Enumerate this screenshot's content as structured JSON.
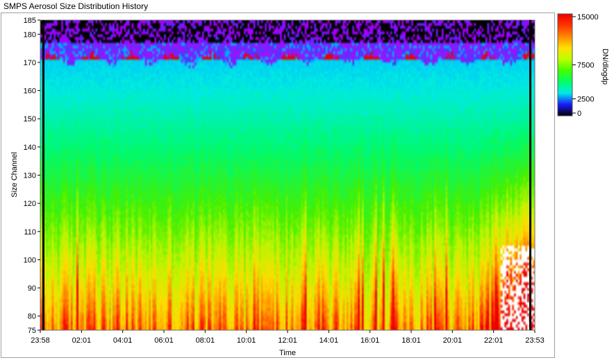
{
  "window_title": "SMPS Aerosol Size Distribution History",
  "colors": {
    "no_data_top": "#000000",
    "saturated": "#ffffff",
    "cursor_line": "#000000"
  },
  "chart_data": {
    "type": "heatmap",
    "title": "",
    "xlabel": "Time",
    "ylabel": "Size Channel",
    "x_ticks": [
      "23:58",
      "02:01",
      "04:01",
      "06:01",
      "08:01",
      "10:01",
      "12:01",
      "14:01",
      "16:01",
      "18:01",
      "20:01",
      "22:01",
      "23:53"
    ],
    "y_ticks": [
      75,
      80,
      90,
      100,
      110,
      120,
      130,
      140,
      150,
      160,
      170,
      180,
      185
    ],
    "ylim": [
      75,
      185
    ],
    "grid": false,
    "colorbar": {
      "label": "DN/dlogdp",
      "ticks": [
        0,
        2500,
        7500,
        15000
      ],
      "tick_labels": [
        "0",
        "2500",
        "7500",
        "15000"
      ],
      "range": [
        0,
        15000
      ],
      "colors": [
        "#000000",
        "#1a1aff",
        "#00e8e8",
        "#00ff66",
        "#44ff00",
        "#bbff00",
        "#ffe000",
        "#ff8800",
        "#ff3300",
        "#ee0000"
      ]
    }
  }
}
